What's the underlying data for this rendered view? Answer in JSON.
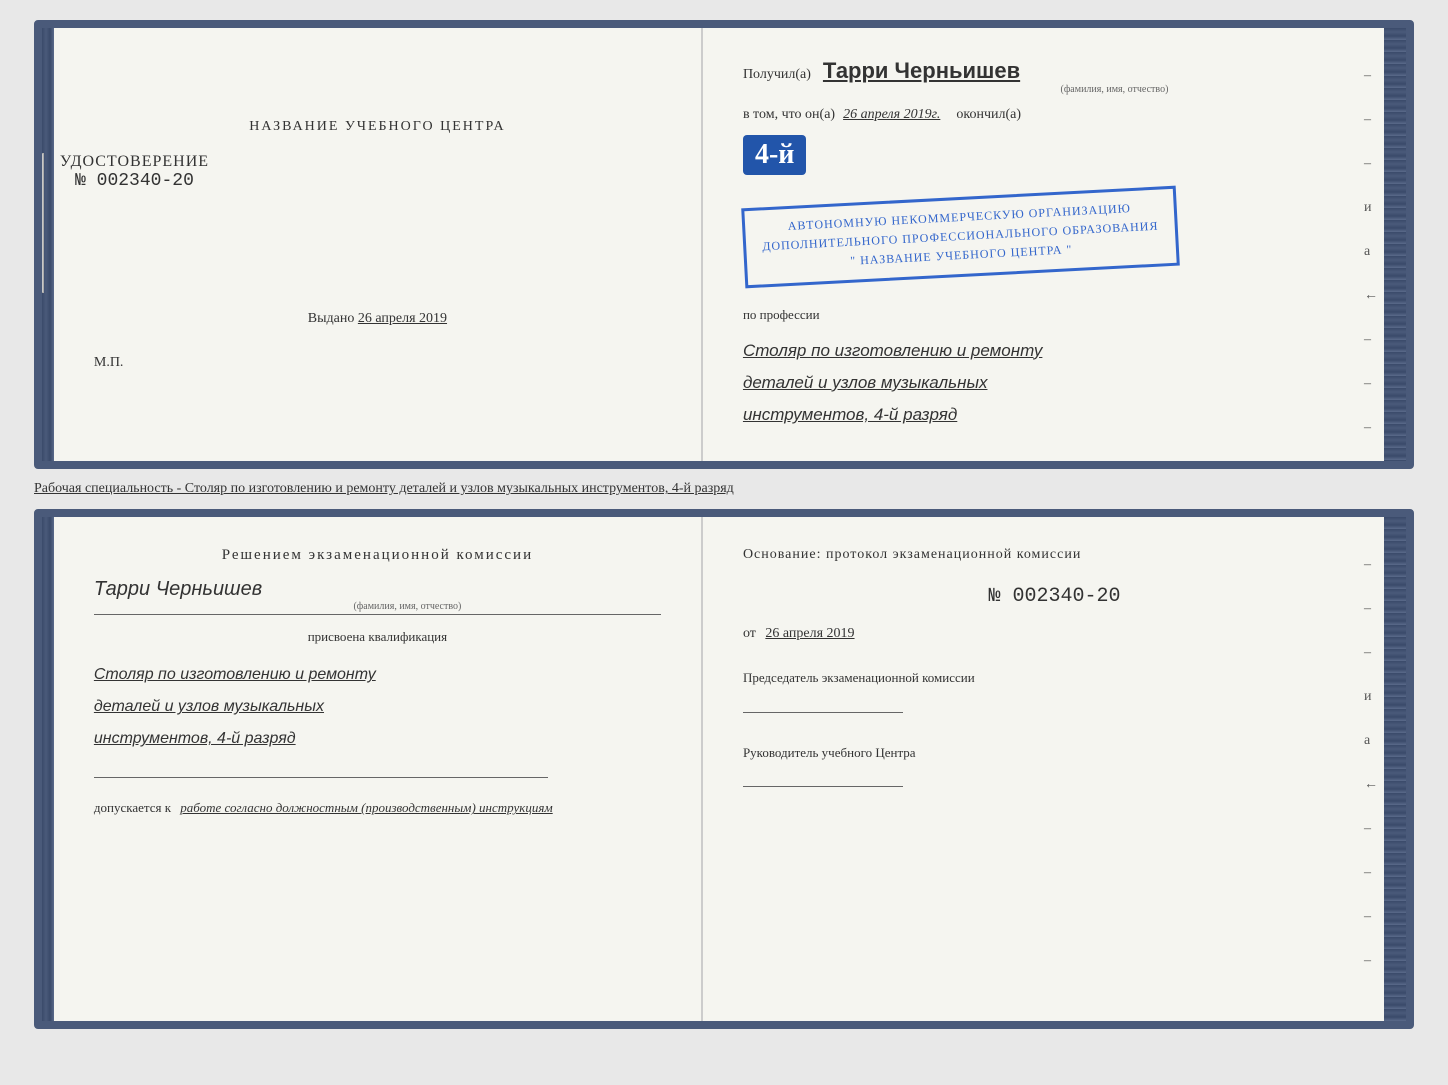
{
  "top_cert": {
    "left": {
      "title": "НАЗВАНИЕ УЧЕБНОГО ЦЕНТРА",
      "udostoverenie_label": "УДОСТОВЕРЕНИЕ",
      "number": "№ 002340-20",
      "vydano_label": "Выдано",
      "vydano_date": "26 апреля 2019",
      "mp_label": "М.П."
    },
    "right": {
      "poluchil_label": "Получил(а)",
      "recipient_name": "Тарри Черньишев",
      "fio_subtitle": "(фамилия, имя, отчество)",
      "vtom_label": "в том, что он(а)",
      "date_handwritten": "26 апреля 2019г.",
      "okonchil_label": "окончил(а)",
      "year_badge": "4-й",
      "stamp_line1": "АВТОНОМНУЮ НЕКОММЕРЧЕСКУЮ ОРГАНИЗАЦИЮ",
      "stamp_line2": "ДОПОЛНИТЕЛЬНОГО ПРОФЕССИОНАЛЬНОГО ОБРАЗОВАНИЯ",
      "stamp_line3": "\" НАЗВАНИЕ УЧЕБНОГО ЦЕНТРА \"",
      "po_professii_label": "по профессии",
      "profession_line1": "Столяр по изготовлению и ремонту",
      "profession_line2": "деталей и узлов музыкальных",
      "profession_line3": "инструментов, 4-й разряд"
    }
  },
  "middle_label": "Рабочая специальность - Столяр по изготовлению и ремонту деталей и узлов музыкальных инструментов, 4-й разряд",
  "bottom_cert": {
    "left": {
      "decision_title": "Решением  экзаменационной  комиссии",
      "name_handwritten": "Тарри Черньишев",
      "fio_subtitle": "(фамилия, имя, отчество)",
      "prisvoena_label": "присвоена квалификация",
      "qualification_line1": "Столяр по изготовлению и ремонту",
      "qualification_line2": "деталей и узлов музыкальных",
      "qualification_line3": "инструментов, 4-й разряд",
      "dopuskaetsya_label": "допускается к",
      "dopuskaetsya_work": "работе согласно должностным (производственным) инструкциям"
    },
    "right": {
      "osnovaniye_label": "Основание: протокол экзаменационной  комиссии",
      "protocol_number": "№  002340-20",
      "ot_label": "от",
      "ot_date": "26 апреля 2019",
      "predsedatel_label": "Председатель экзаменационной комиссии",
      "rukovoditel_label": "Руководитель учебного Центра"
    }
  },
  "dash_marks": [
    "-",
    "-",
    "-",
    "и",
    "а",
    "←",
    "-",
    "-",
    "-",
    "-",
    "-",
    "-"
  ]
}
